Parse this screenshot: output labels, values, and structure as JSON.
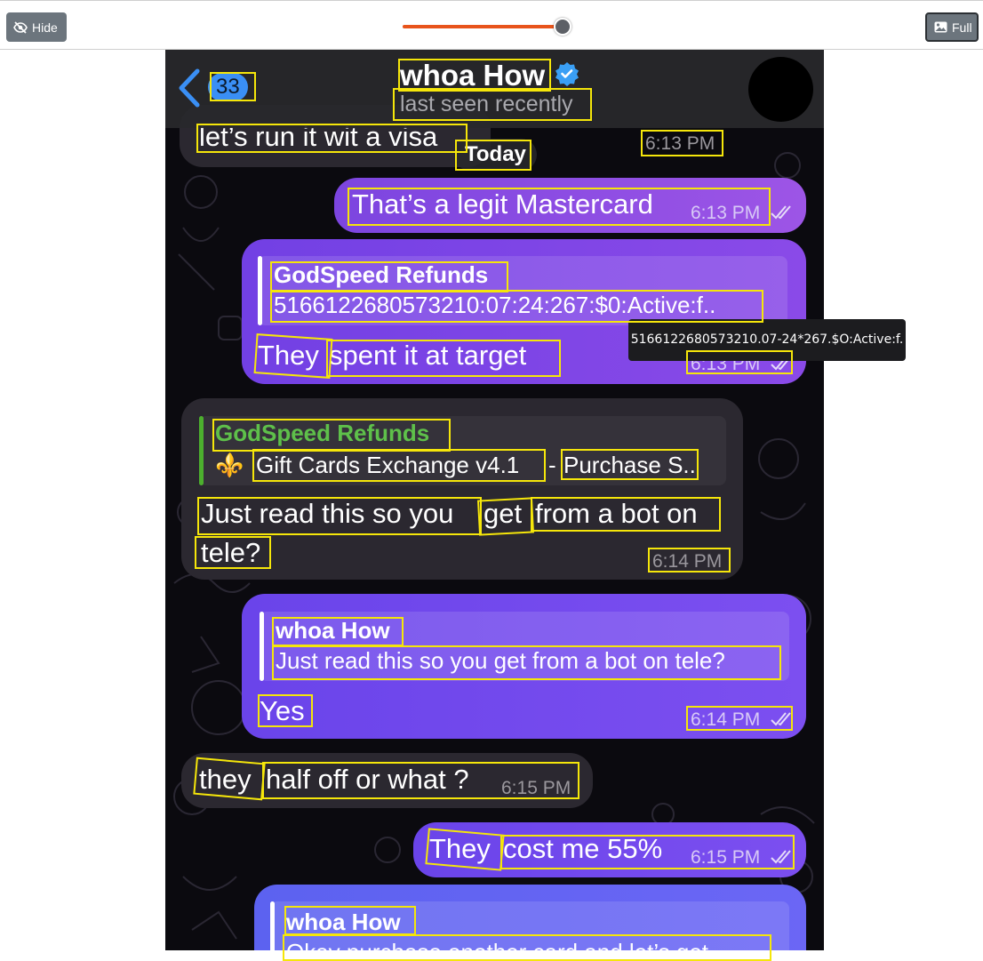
{
  "toolbar": {
    "hide_label": "Hide",
    "full_label": "Full",
    "slider_fraction": 0.98,
    "accent": "#e8541b"
  },
  "header": {
    "unread_count": "33",
    "contact_name": "whoa How",
    "status": "last seen recently"
  },
  "date_separator": "Today",
  "messages": [
    {
      "direction": "in",
      "text": "let’s run it wit a visa",
      "time": "6:13 PM"
    },
    {
      "direction": "out",
      "text": "That’s a legit Mastercard",
      "time": "6:13 PM"
    },
    {
      "direction": "out",
      "reply": {
        "name": "GodSpeed Refunds",
        "text": "5166122680573210:07:24:267:$0:Active:f.."
      },
      "text_parts": [
        "They",
        "spent it at target"
      ],
      "time": "6:13 PM"
    },
    {
      "direction": "in",
      "reply": {
        "name": "GodSpeed Refunds",
        "emoji": "⚜️",
        "text_part1": "Gift Cards Exchange v4.1",
        "separator": "-",
        "text_part2": "Purchase S.."
      },
      "text_parts": [
        "Just read this so you",
        "get",
        "from a bot on",
        "tele?"
      ],
      "time": "6:14 PM"
    },
    {
      "direction": "out",
      "reply": {
        "name": "whoa How",
        "text": "Just read this so you get from a bot on tele?"
      },
      "text": "Yes",
      "time": "6:14 PM"
    },
    {
      "direction": "in",
      "text_parts": [
        "they",
        "half off or what ?"
      ],
      "time": "6:15 PM"
    },
    {
      "direction": "out",
      "text_parts": [
        "They",
        "cost me 55%"
      ],
      "time": "6:15 PM"
    },
    {
      "direction": "out",
      "reply": {
        "name": "whoa How",
        "text": "Okay purchase another card and let’s get"
      }
    }
  ],
  "tooltip": "5166122680573210.07-24*267.$O:Active:f.",
  "colors": {
    "incoming_bubble": "#2b2830",
    "outgoing_bubble": "#8a4ae8",
    "reply_name_green": "#5ec04a",
    "verified_blue": "#3a9ff5",
    "annotation_box": "#f5e60a"
  }
}
